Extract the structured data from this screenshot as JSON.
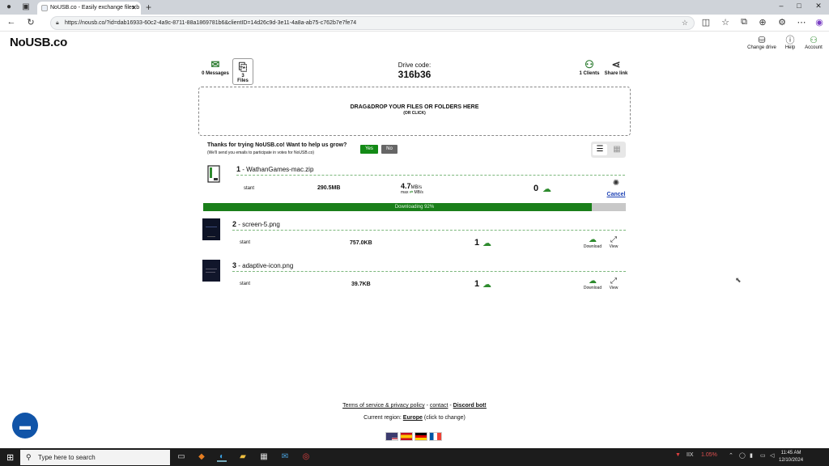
{
  "browser": {
    "tab_title": "NoUSB.co - Easily exchange files b",
    "tab_close": "✕",
    "new_tab": "+",
    "url": "https://nousb.co/?id=dab16933-60c2-4a9c-8711-88a1869781b6&clientID=14d26c9d-3e11-4a8a-ab75-c762b7e7fe74",
    "window_controls": {
      "minimize": "–",
      "maximize": "□",
      "close": "✕"
    }
  },
  "header": {
    "logo": "NoUSB.co",
    "change_drive": "Change drive",
    "help": "Help",
    "account": "Account"
  },
  "top": {
    "messages_label": "0 Messages",
    "files_label": "3 Files",
    "drive_code_label": "Drive code:",
    "drive_code": "316b36",
    "clients_label": "1 Clients",
    "share_label": "Share link"
  },
  "dropzone": {
    "title": "DRAG&DROP YOUR FILES OR FOLDERS HERE",
    "subtitle": "(OR CLICK)"
  },
  "promo": {
    "question": "Thanks for trying NoUSB.co! Want to help us grow?",
    "note": "(We'll send you emails to participate in votes for NoUSB.co)",
    "yes": "Yes",
    "no": "No"
  },
  "files": [
    {
      "index": "1",
      "name": " - WathanGames-mac.zip",
      "owner": "stant",
      "size": "290.5MB",
      "speed": "4.7",
      "speed_unit": "MB/s",
      "speed_max_label": "max",
      "speed_max_unit": "MB/s",
      "downloads": "0",
      "cancel": "Cancel",
      "progress_text": "Downloading 92%",
      "progress": 0.92
    },
    {
      "index": "2",
      "name": " - screen-5.png",
      "owner": "stant",
      "size": "757.0KB",
      "downloads": "1",
      "download": "Download",
      "view": "View"
    },
    {
      "index": "3",
      "name": " - adaptive-icon.png",
      "owner": "stant",
      "size": "39.7KB",
      "downloads": "1",
      "download": "Download",
      "view": "View"
    }
  ],
  "footer": {
    "terms": "Terms of service & privacy policy",
    "sep1": " - ",
    "contact": "contact",
    "sep2": " - ",
    "discord": "Discord bot!",
    "region_prefix": "Current region: ",
    "region": "Europe",
    "region_suffix": " (click to change)"
  },
  "taskbar": {
    "search_placeholder": "Type here to search",
    "ticker": "IIX",
    "ticker_change": "1.05%",
    "time": "11:45 AM",
    "date": "12/10/2024"
  },
  "colors": {
    "brand_green": "#138a16",
    "progress_green": "#1a7f1a",
    "chat_blue": "#1054a8"
  }
}
